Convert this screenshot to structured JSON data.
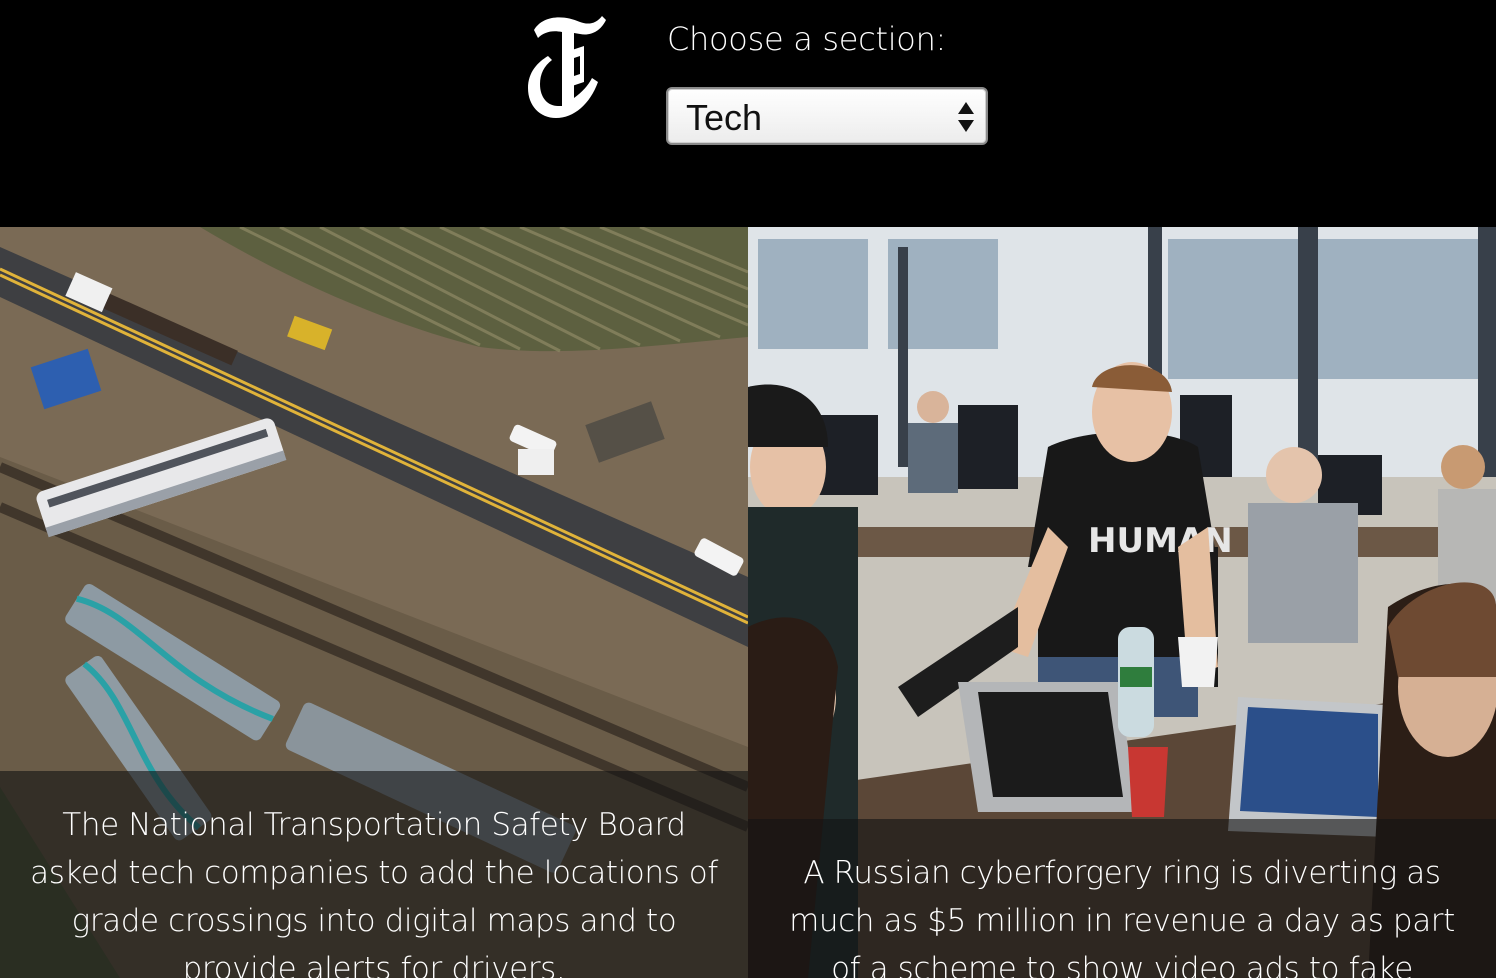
{
  "header": {
    "section_label": "Choose a section:",
    "selected_section": "Tech"
  },
  "stories": [
    {
      "caption": "The National Transportation Safety Board asked tech companies to add the locations of grade crossings into digital maps and to provide alerts for drivers."
    },
    {
      "caption": "A Russian cyberforgery ring is diverting as much as $5 million in revenue a day as part of a scheme to show video ads to fake internet users."
    }
  ],
  "colors": {
    "background": "#000000",
    "caption_overlay": "rgba(20,20,20,0.62)",
    "text": "#ffffff"
  }
}
